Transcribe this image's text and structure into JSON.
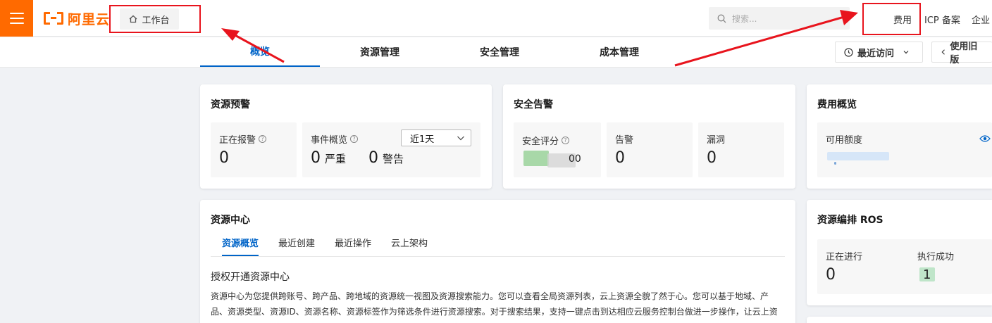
{
  "topbar": {
    "brand": "阿里云",
    "workbench": "工作台",
    "search_placeholder": "搜索...",
    "links": [
      "费用",
      "ICP 备案",
      "企业"
    ]
  },
  "subnav": {
    "tabs": [
      "概览",
      "资源管理",
      "安全管理",
      "成本管理"
    ],
    "recent": "最近访问",
    "old_version": "使用旧版"
  },
  "alert_card": {
    "title": "资源预警",
    "alarming_label": "正在报警",
    "alarming_value": "0",
    "events_label": "事件概览",
    "period": "近1天",
    "severe_value": "0",
    "severe_label": "严重",
    "warning_value": "0",
    "warning_label": "警告"
  },
  "security_card": {
    "title": "安全告警",
    "score_label": "安全评分",
    "score_value": "00",
    "alerts_label": "告警",
    "alerts_value": "0",
    "vuln_label": "漏洞",
    "vuln_value": "0"
  },
  "cost_card": {
    "title": "费用概览",
    "available_label": "可用额度"
  },
  "resource_center": {
    "title": "资源中心",
    "tabs": [
      "资源概览",
      "最近创建",
      "最近操作",
      "云上架构"
    ],
    "heading": "授权开通资源中心",
    "description": "资源中心为您提供跨账号、跨产品、跨地域的资源统一视图及资源搜索能力。您可以查看全局资源列表，云上资源全貌了然于心。您可以基于地域、产品、资源类型、资源ID、资源名称、资源标签作为筛选条件进行资源搜索。对于搜索结果，支持一键点击到达相应云服务控制台做进一步操作，让云上资"
  },
  "ros_card": {
    "title": "资源编排 ROS",
    "running_label": "正在进行",
    "running_value": "0",
    "success_label": "执行成功",
    "success_value": "1"
  },
  "colors": {
    "brand": "#ff6a00",
    "active_blue": "#0064c8",
    "annotation_red": "#e8141d"
  }
}
